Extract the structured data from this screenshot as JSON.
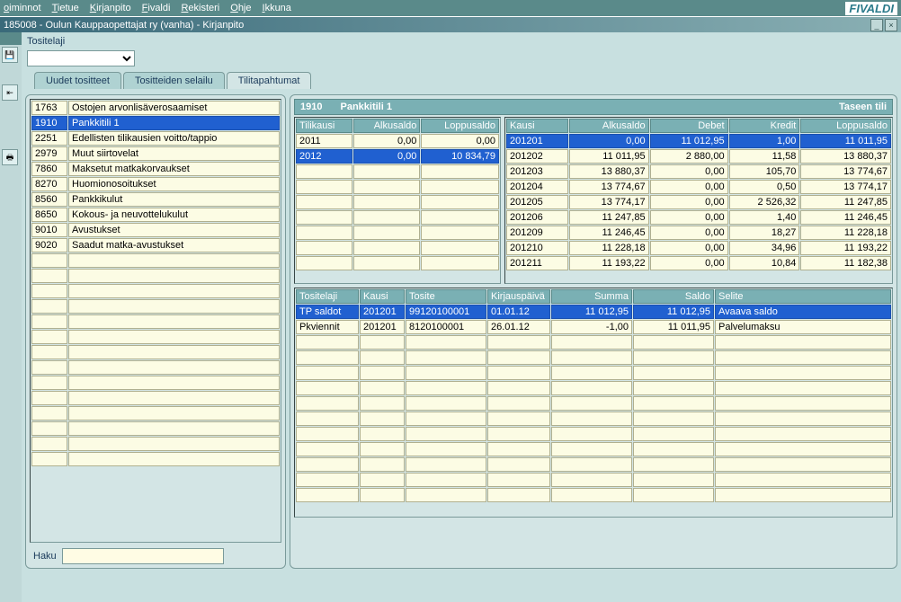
{
  "menu": [
    "oiminnot",
    "Tietue",
    "Kirjanpito",
    "Fivaldi",
    "Rekisteri",
    "Ohje",
    "Ikkuna"
  ],
  "menu_underlines": [
    "o",
    "T",
    "K",
    "F",
    "R",
    "O",
    "I"
  ],
  "logo": "FIVALDI",
  "window_title": "185008 - Oulun Kauppaopettajat ry (vanha) - Kirjanpito",
  "tositelaji_label": "Tositelaji",
  "tabs": [
    "Uudet tositteet",
    "Tositteiden selailu",
    "Tilitapahtumat"
  ],
  "active_tab": 2,
  "accounts": [
    {
      "code": "1763",
      "name": "Ostojen arvonlisäverosaamiset"
    },
    {
      "code": "1910",
      "name": "Pankkitili 1"
    },
    {
      "code": "2251",
      "name": "Edellisten tilikausien voitto/tappio"
    },
    {
      "code": "2979",
      "name": "Muut siirtovelat"
    },
    {
      "code": "7860",
      "name": "Maksetut matkakorvaukset"
    },
    {
      "code": "8270",
      "name": "Huomionosoitukset"
    },
    {
      "code": "8560",
      "name": "Pankkikulut"
    },
    {
      "code": "8650",
      "name": "Kokous- ja neuvottelukulut"
    },
    {
      "code": "9010",
      "name": "Avustukset"
    },
    {
      "code": "9020",
      "name": "Saadut matka-avustukset"
    }
  ],
  "selected_account_idx": 1,
  "haku_label": "Haku",
  "header": {
    "code": "1910",
    "name": "Pankkitili 1",
    "type": "Taseen tili"
  },
  "tilikausi_cols": [
    "Tilikausi",
    "Alkusaldo",
    "Loppusaldo"
  ],
  "tilikausi_rows": [
    {
      "y": "2011",
      "alku": "0,00",
      "loppu": "0,00"
    },
    {
      "y": "2012",
      "alku": "0,00",
      "loppu": "10 834,79"
    }
  ],
  "tilikausi_sel": 1,
  "kausi_cols": [
    "Kausi",
    "Alkusaldo",
    "Debet",
    "Kredit",
    "Loppusaldo"
  ],
  "kausi_rows": [
    {
      "k": "201201",
      "a": "0,00",
      "d": "11 012,95",
      "kr": "1,00",
      "l": "11 011,95"
    },
    {
      "k": "201202",
      "a": "11 011,95",
      "d": "2 880,00",
      "kr": "11,58",
      "l": "13 880,37"
    },
    {
      "k": "201203",
      "a": "13 880,37",
      "d": "0,00",
      "kr": "105,70",
      "l": "13 774,67"
    },
    {
      "k": "201204",
      "a": "13 774,67",
      "d": "0,00",
      "kr": "0,50",
      "l": "13 774,17"
    },
    {
      "k": "201205",
      "a": "13 774,17",
      "d": "0,00",
      "kr": "2 526,32",
      "l": "11 247,85"
    },
    {
      "k": "201206",
      "a": "11 247,85",
      "d": "0,00",
      "kr": "1,40",
      "l": "11 246,45"
    },
    {
      "k": "201209",
      "a": "11 246,45",
      "d": "0,00",
      "kr": "18,27",
      "l": "11 228,18"
    },
    {
      "k": "201210",
      "a": "11 228,18",
      "d": "0,00",
      "kr": "34,96",
      "l": "11 193,22"
    },
    {
      "k": "201211",
      "a": "11 193,22",
      "d": "0,00",
      "kr": "10,84",
      "l": "11 182,38"
    }
  ],
  "kausi_sel": 0,
  "detail_cols": [
    "Tositelaji",
    "Kausi",
    "Tosite",
    "Kirjauspäivä",
    "Summa",
    "Saldo",
    "Selite"
  ],
  "detail_rows": [
    {
      "t": "TP saldot",
      "k": "201201",
      "to": "99120100001",
      "p": "01.01.12",
      "s": "11 012,95",
      "sa": "11 012,95",
      "se": "Avaava saldo"
    },
    {
      "t": "Pkviennit",
      "k": "201201",
      "to": "8120100001",
      "p": "26.01.12",
      "s": "-1,00",
      "sa": "11 011,95",
      "se": "Palvelumaksu"
    }
  ],
  "detail_sel": 0
}
